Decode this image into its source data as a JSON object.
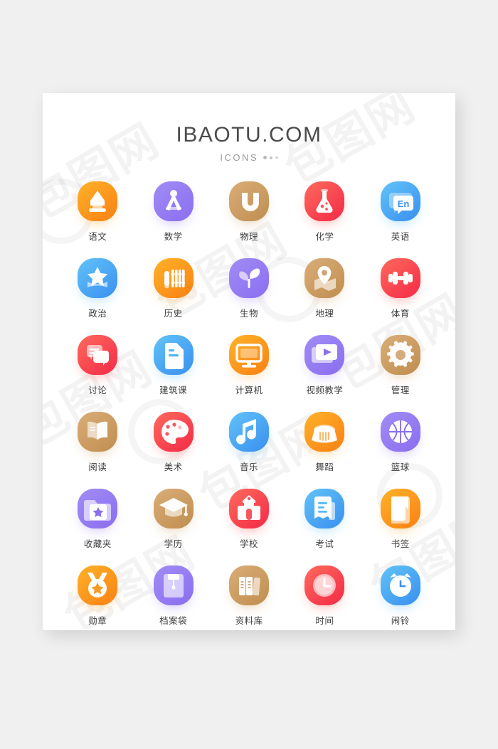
{
  "background_color": "#f0f0f0",
  "card_color": "#ffffff",
  "header": {
    "title": "IBAOTU.COM",
    "subtitle": "ICONS",
    "dots_count": 3,
    "title_color": "#4b4b4b",
    "subtitle_color": "#9a9a9a"
  },
  "watermark": {
    "text": "包图网",
    "color": "rgba(120,120,120,0.085)"
  },
  "palette": {
    "orange": {
      "from": "#ffb229",
      "to": "#f98014",
      "glow": "#ffb347"
    },
    "purple": {
      "from": "#a18cf5",
      "to": "#8a6ef0",
      "glow": "#a78bf5"
    },
    "tan": {
      "from": "#d9ae78",
      "to": "#c08d4f",
      "glow": "#d6a86f"
    },
    "red": {
      "from": "#fd6a5e",
      "to": "#f42a46",
      "glow": "#fc6b62"
    },
    "blue": {
      "from": "#61c3f8",
      "to": "#3a8fef",
      "glow": "#6bc2f7"
    }
  },
  "label_color": "#3f3f3f",
  "icons": [
    {
      "label": "语文",
      "icon": "pen-nib-icon",
      "color": "orange"
    },
    {
      "label": "数学",
      "icon": "compass-icon",
      "color": "purple"
    },
    {
      "label": "物理",
      "icon": "magnet-icon",
      "color": "tan"
    },
    {
      "label": "化学",
      "icon": "flask-icon",
      "color": "red"
    },
    {
      "label": "英语",
      "icon": "speech-bubble-en-icon",
      "color": "blue",
      "glyph": "En"
    },
    {
      "label": "政治",
      "icon": "star-badge-icon",
      "color": "blue"
    },
    {
      "label": "历史",
      "icon": "bamboo-scroll-icon",
      "color": "orange"
    },
    {
      "label": "生物",
      "icon": "sprout-icon",
      "color": "purple"
    },
    {
      "label": "地理",
      "icon": "map-pin-icon",
      "color": "tan"
    },
    {
      "label": "体育",
      "icon": "dumbbell-icon",
      "color": "red"
    },
    {
      "label": "讨论",
      "icon": "chat-bubbles-icon",
      "color": "red"
    },
    {
      "label": "建筑课",
      "icon": "document-icon",
      "color": "blue"
    },
    {
      "label": "计算机",
      "icon": "monitor-icon",
      "color": "orange"
    },
    {
      "label": "视频教学",
      "icon": "video-play-icon",
      "color": "purple"
    },
    {
      "label": "管理",
      "icon": "gear-icon",
      "color": "tan"
    },
    {
      "label": "阅读",
      "icon": "open-book-icon",
      "color": "tan"
    },
    {
      "label": "美术",
      "icon": "palette-brush-icon",
      "color": "red"
    },
    {
      "label": "音乐",
      "icon": "music-note-icon",
      "color": "blue"
    },
    {
      "label": "舞蹈",
      "icon": "tutu-skirt-icon",
      "color": "orange"
    },
    {
      "label": "篮球",
      "icon": "basketball-icon",
      "color": "purple"
    },
    {
      "label": "收藏夹",
      "icon": "folder-star-icon",
      "color": "purple"
    },
    {
      "label": "学历",
      "icon": "graduation-cap-icon",
      "color": "tan"
    },
    {
      "label": "学校",
      "icon": "school-building-icon",
      "color": "red"
    },
    {
      "label": "考试",
      "icon": "exam-paper-icon",
      "color": "blue"
    },
    {
      "label": "书签",
      "icon": "bookmark-icon",
      "color": "orange"
    },
    {
      "label": "勋章",
      "icon": "medal-icon",
      "color": "orange"
    },
    {
      "label": "档案袋",
      "icon": "file-envelope-icon",
      "color": "purple"
    },
    {
      "label": "资料库",
      "icon": "book-archive-icon",
      "color": "tan"
    },
    {
      "label": "时间",
      "icon": "clock-icon",
      "color": "red"
    },
    {
      "label": "闹铃",
      "icon": "alarm-clock-icon",
      "color": "blue"
    }
  ]
}
